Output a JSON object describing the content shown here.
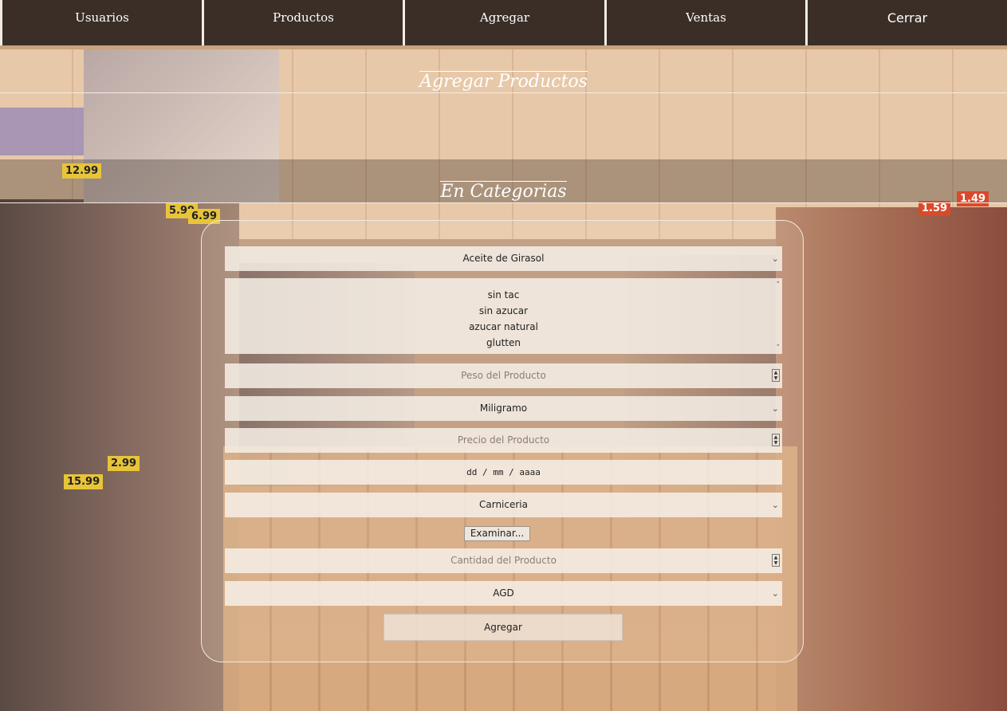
{
  "nav": {
    "items": [
      "Usuarios",
      "Productos",
      "Agregar",
      "Ventas",
      "Cerrar"
    ]
  },
  "headings": {
    "add_products": "Agregar Productos",
    "in_categories": "En Categorias"
  },
  "form": {
    "product_select": "Aceite de Girasol",
    "tags_list": [
      "sin tac",
      "sin azucar",
      "azucar natural",
      "glutten"
    ],
    "weight_placeholder": "Peso del Producto",
    "unit_select": "Miligramo",
    "price_placeholder": "Precio del Producto",
    "date_placeholder": "dd / mm / aaaa",
    "category_select": "Carniceria",
    "file_button": "Examinar...",
    "quantity_placeholder": "Cantidad del Producto",
    "brand_select": "AGD",
    "submit_label": "Agregar"
  },
  "background": {
    "price_tags": [
      "12.99",
      "5.99",
      "6.99",
      "1.59",
      "1.49",
      "2.99",
      "15.99"
    ]
  },
  "colors": {
    "nav_bg": "#3a2e27",
    "nav_divider": "#f3ece6",
    "accent_line": "#c9a37c"
  }
}
